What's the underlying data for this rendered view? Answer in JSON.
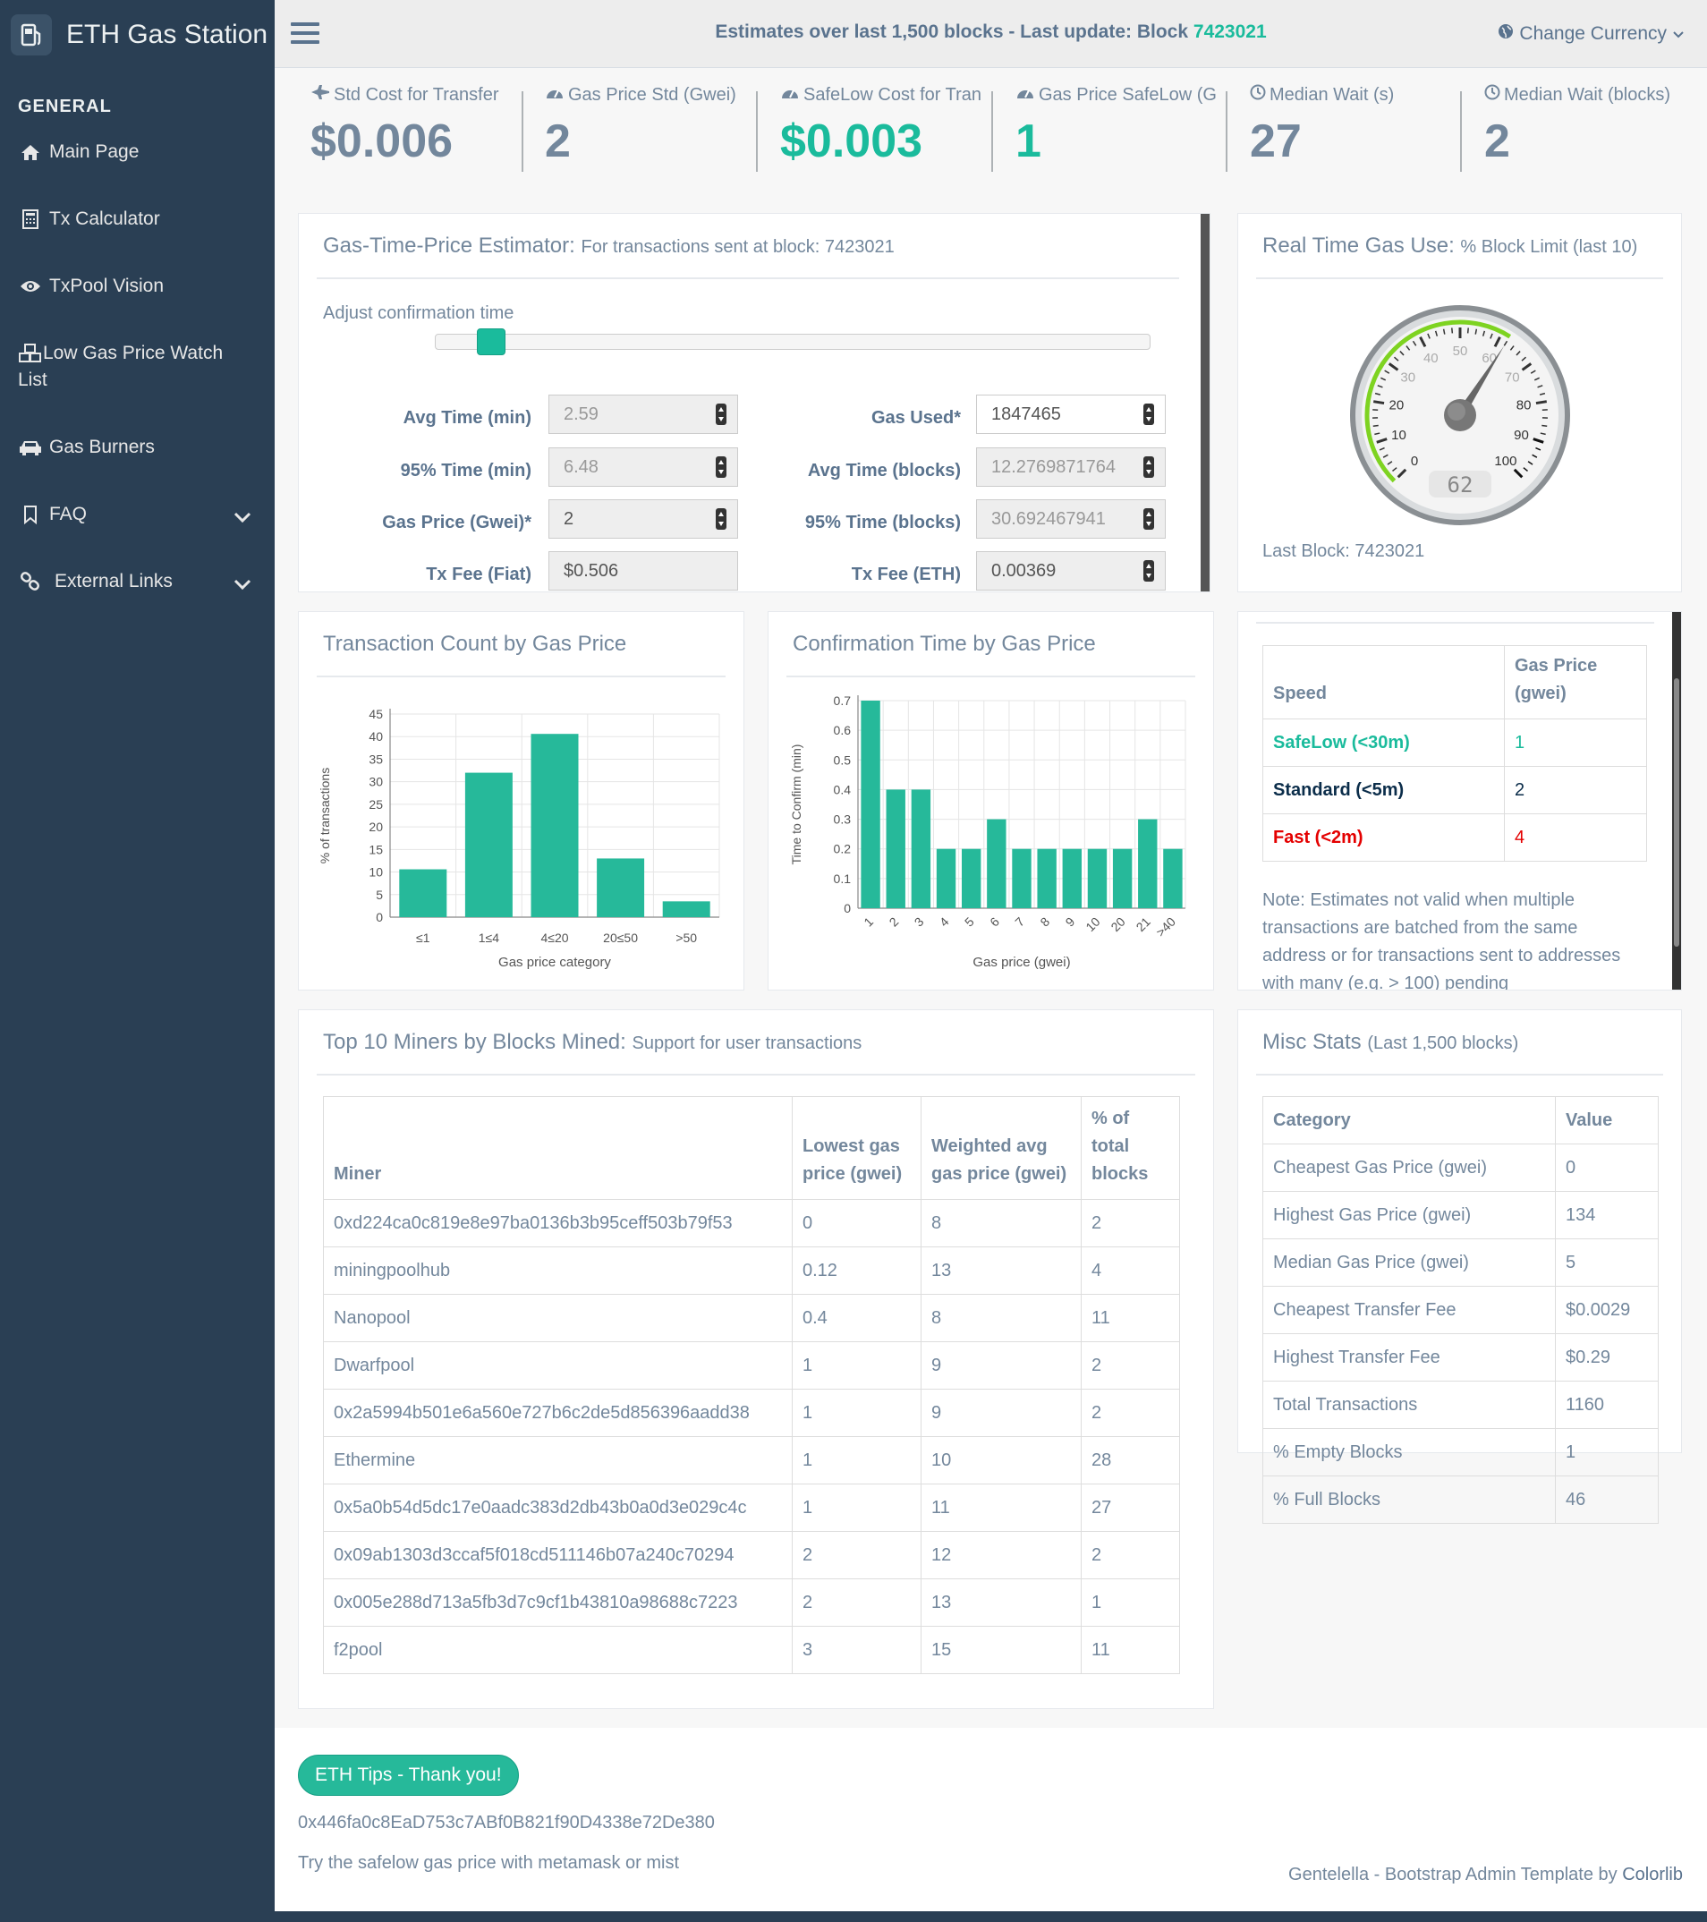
{
  "brand": {
    "name": "ETH Gas Station"
  },
  "sidebar": {
    "section": "GENERAL",
    "items": [
      {
        "label": "Main Page",
        "icon": "home-icon"
      },
      {
        "label": "Tx Calculator",
        "icon": "calculator-icon"
      },
      {
        "label": "TxPool Vision",
        "icon": "eye-icon"
      },
      {
        "label": "Low Gas Price Watch List",
        "icon": "cubes-icon"
      },
      {
        "label": "Gas Burners",
        "icon": "car-icon"
      },
      {
        "label": "FAQ",
        "icon": "bookmark-icon"
      },
      {
        "label": "External Links",
        "icon": "link-icon"
      }
    ]
  },
  "topbar": {
    "title_prefix": "Estimates over last 1,500 blocks - Last update: Block ",
    "block": "7423021",
    "currency": "Change Currency"
  },
  "tiles": [
    {
      "label": "Std Cost for Transfer",
      "value": "$0.006",
      "green": false,
      "icon": "plane-icon"
    },
    {
      "label": "Gas Price Std (Gwei)",
      "value": "2",
      "green": false,
      "icon": "dashboard-icon"
    },
    {
      "label": "SafeLow Cost for Transfer",
      "value": "$0.003",
      "green": true,
      "icon": "dashboard-icon"
    },
    {
      "label": "Gas Price SafeLow (Gwei)",
      "value": "1",
      "green": true,
      "icon": "dashboard-icon"
    },
    {
      "label": "Median Wait (s)",
      "value": "27",
      "green": false,
      "icon": "clock-icon"
    },
    {
      "label": "Median Wait (blocks)",
      "value": "2",
      "green": false,
      "icon": "clock-icon"
    }
  ],
  "estimator": {
    "title": "Gas-Time-Price Estimator:",
    "subtitle": "For transactions sent at block: 7423021",
    "slider_label": "Adjust confirmation time",
    "slider_position": 0.06,
    "fields": {
      "avg_time_min": {
        "label": "Avg Time (min)",
        "value": "2.59"
      },
      "pct95_time_min": {
        "label": "95% Time (min)",
        "value": "6.48"
      },
      "gas_price": {
        "label": "Gas Price (Gwei)*",
        "value": "2"
      },
      "tx_fee_fiat": {
        "label": "Tx Fee (Fiat)",
        "value": "$0.506"
      },
      "gas_used": {
        "label": "Gas Used*",
        "value": "1847465"
      },
      "avg_time_blocks": {
        "label": "Avg Time (blocks)",
        "value": "12.2769871764"
      },
      "pct95_time_blocks": {
        "label": "95% Time (blocks)",
        "value": "30.692467941"
      },
      "tx_fee_eth": {
        "label": "Tx Fee (ETH)",
        "value": "0.00369"
      }
    }
  },
  "gauge": {
    "title": "Real Time Gas Use:",
    "subtitle": "% Block Limit (last 10)",
    "value": 62,
    "display": "62",
    "ticks": [
      "0",
      "10",
      "20",
      "30",
      "40",
      "50",
      "60",
      "70",
      "80",
      "90",
      "100"
    ],
    "last_block": "Last Block: 7423021"
  },
  "count_chart": {
    "title": "Transaction Count by Gas Price",
    "chart_data": {
      "type": "bar",
      "categories": [
        "≤1",
        "1≤4",
        "4≤20",
        "20≤50",
        ">50"
      ],
      "values": [
        10.6,
        32,
        40.6,
        13,
        3.5
      ],
      "xlabel": "Gas price category",
      "ylabel": "% of transactions",
      "ylim": [
        0,
        45
      ],
      "yticks": [
        "0",
        "5",
        "10",
        "15",
        "20",
        "25",
        "30",
        "35",
        "40",
        "45"
      ],
      "grid": true,
      "color": "#26B99A"
    }
  },
  "confirm_chart": {
    "title": "Confirmation Time by Gas Price",
    "chart_data": {
      "type": "bar",
      "categories": [
        "1",
        "2",
        "3",
        "4",
        "5",
        "6",
        "7",
        "8",
        "9",
        "10",
        "20",
        "21",
        ">40"
      ],
      "values": [
        0.7,
        0.4,
        0.4,
        0.2,
        0.2,
        0.3,
        0.2,
        0.2,
        0.2,
        0.2,
        0.2,
        0.3,
        0.2
      ],
      "xlabel": "Gas price (gwei)",
      "ylabel": "Time to Confirm (min)",
      "ylim": [
        0,
        0.7
      ],
      "yticks": [
        "0",
        "0.1",
        "0.2",
        "0.3",
        "0.4",
        "0.5",
        "0.6",
        "0.7"
      ],
      "grid": true,
      "color": "#26B99A"
    }
  },
  "speed_table": {
    "headers": [
      "Speed",
      "Gas Price (gwei)"
    ],
    "rows": [
      {
        "speed": "SafeLow (<30m)",
        "price": "1",
        "color": "#1ABB9C"
      },
      {
        "speed": "Standard (<5m)",
        "price": "2",
        "color": "#0B2D4A"
      },
      {
        "speed": "Fast (<2m)",
        "price": "4",
        "color": "#E40000"
      }
    ],
    "note": "Note: Estimates not valid when multiple transactions are batched from the same address or for transactions sent to addresses with many (e.g. > 100) pending"
  },
  "miners": {
    "title": "Top 10 Miners by Blocks Mined:",
    "subtitle": "Support for user transactions",
    "headers": [
      "Miner",
      "Lowest gas price (gwei)",
      "Weighted avg gas price (gwei)",
      "% of total blocks"
    ],
    "rows": [
      [
        "0xd224ca0c819e8e97ba0136b3b95ceff503b79f53",
        "0",
        "8",
        "2"
      ],
      [
        "miningpoolhub",
        "0.12",
        "13",
        "4"
      ],
      [
        "Nanopool",
        "0.4",
        "8",
        "11"
      ],
      [
        "Dwarfpool",
        "1",
        "9",
        "2"
      ],
      [
        "0x2a5994b501e6a560e727b6c2de5d856396aadd38",
        "1",
        "9",
        "2"
      ],
      [
        "Ethermine",
        "1",
        "10",
        "28"
      ],
      [
        "0x5a0b54d5dc17e0aadc383d2db43b0a0d3e029c4c",
        "1",
        "11",
        "27"
      ],
      [
        "0x09ab1303d3ccaf5f018cd511146b07a240c70294",
        "2",
        "12",
        "2"
      ],
      [
        "0x005e288d713a5fb3d7c9cf1b43810a98688c7223",
        "2",
        "13",
        "1"
      ],
      [
        "f2pool",
        "3",
        "15",
        "11"
      ]
    ]
  },
  "misc": {
    "title": "Misc Stats",
    "subtitle": "(Last 1,500 blocks)",
    "headers": [
      "Category",
      "Value"
    ],
    "rows": [
      [
        "Cheapest Gas Price (gwei)",
        "0"
      ],
      [
        "Highest Gas Price (gwei)",
        "134"
      ],
      [
        "Median Gas Price (gwei)",
        "5"
      ],
      [
        "Cheapest Transfer Fee",
        "$0.0029"
      ],
      [
        "Highest Transfer Fee",
        "$0.29"
      ],
      [
        "Total Transactions",
        "1160"
      ],
      [
        "% Empty Blocks",
        "1"
      ],
      [
        "% Full Blocks",
        "46"
      ]
    ]
  },
  "footer": {
    "tip_button": "ETH Tips - Thank you!",
    "address": "0x446fa0c8EaD753c7ABf0B821f90D4338e72De380",
    "try_text": "Try the safelow gas price with metamask or mist",
    "credit": "Gentelella - Bootstrap Admin Template by ",
    "credit_link": "Colorlib"
  }
}
